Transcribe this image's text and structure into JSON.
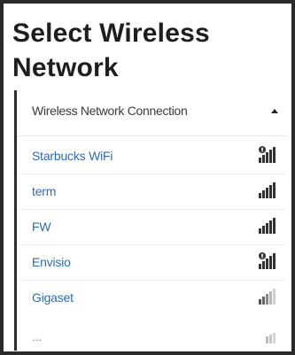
{
  "title": "Select Wireless Network",
  "panel": {
    "header": "Wireless Network Connection",
    "caret_icon": "chevron-up-icon"
  },
  "networks": [
    {
      "name": "Starbucks WiFi",
      "icon": "signal-full-shield-icon",
      "secured": false,
      "strength": 5
    },
    {
      "name": "term",
      "icon": "signal-full-icon",
      "secured": true,
      "strength": 5
    },
    {
      "name": "FW",
      "icon": "signal-full-icon",
      "secured": true,
      "strength": 5
    },
    {
      "name": "Envisio",
      "icon": "signal-full-shield-icon",
      "secured": false,
      "strength": 5
    },
    {
      "name": "Gigaset",
      "icon": "signal-weak-icon",
      "secured": true,
      "strength": 3
    },
    {
      "name": "...",
      "icon": "signal-weak-icon",
      "secured": true,
      "strength": 2
    }
  ],
  "colors": {
    "network_link": "#2f6bb2",
    "title": "#1e1e1e",
    "signal": "#333333",
    "signal_dim": "#b5b5b5"
  }
}
